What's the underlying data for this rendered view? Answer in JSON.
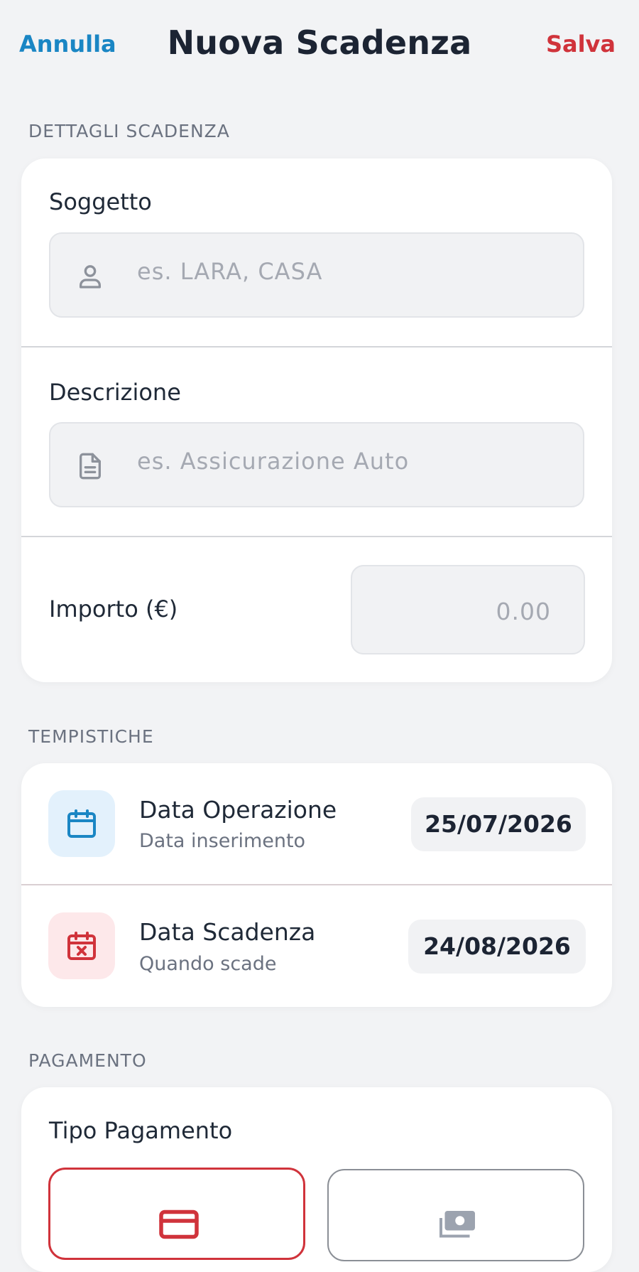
{
  "header": {
    "cancel_label": "Annulla",
    "title": "Nuova Scadenza",
    "save_label": "Salva"
  },
  "details": {
    "section_label": "DETTAGLI SCADENZA",
    "subject": {
      "label": "Soggetto",
      "placeholder": "es. LARA, CASA",
      "icon": "person-icon"
    },
    "description": {
      "label": "Descrizione",
      "placeholder": "es. Assicurazione Auto",
      "icon": "document-icon"
    },
    "amount": {
      "label": "Importo (€)",
      "placeholder": "0.00"
    }
  },
  "timing": {
    "section_label": "TEMPISTICHE",
    "operation_date": {
      "title": "Data Operazione",
      "subtitle": "Data inserimento",
      "value": "25/07/2026",
      "icon": "calendar-icon",
      "accent": "#1a86c4",
      "tile_bg": "#e3f1fc"
    },
    "due_date": {
      "title": "Data Scadenza",
      "subtitle": "Quando scade",
      "value": "24/08/2026",
      "icon": "calendar-x-icon",
      "accent": "#d0333b",
      "tile_bg": "#fde8ea"
    }
  },
  "payment": {
    "section_label": "PAGAMENTO",
    "type_label": "Tipo Pagamento",
    "options": [
      {
        "icon": "credit-card-icon",
        "selected": true,
        "accent": "#d0333b"
      },
      {
        "icon": "cash-icon",
        "selected": false,
        "accent": "#9ca3af"
      }
    ]
  }
}
